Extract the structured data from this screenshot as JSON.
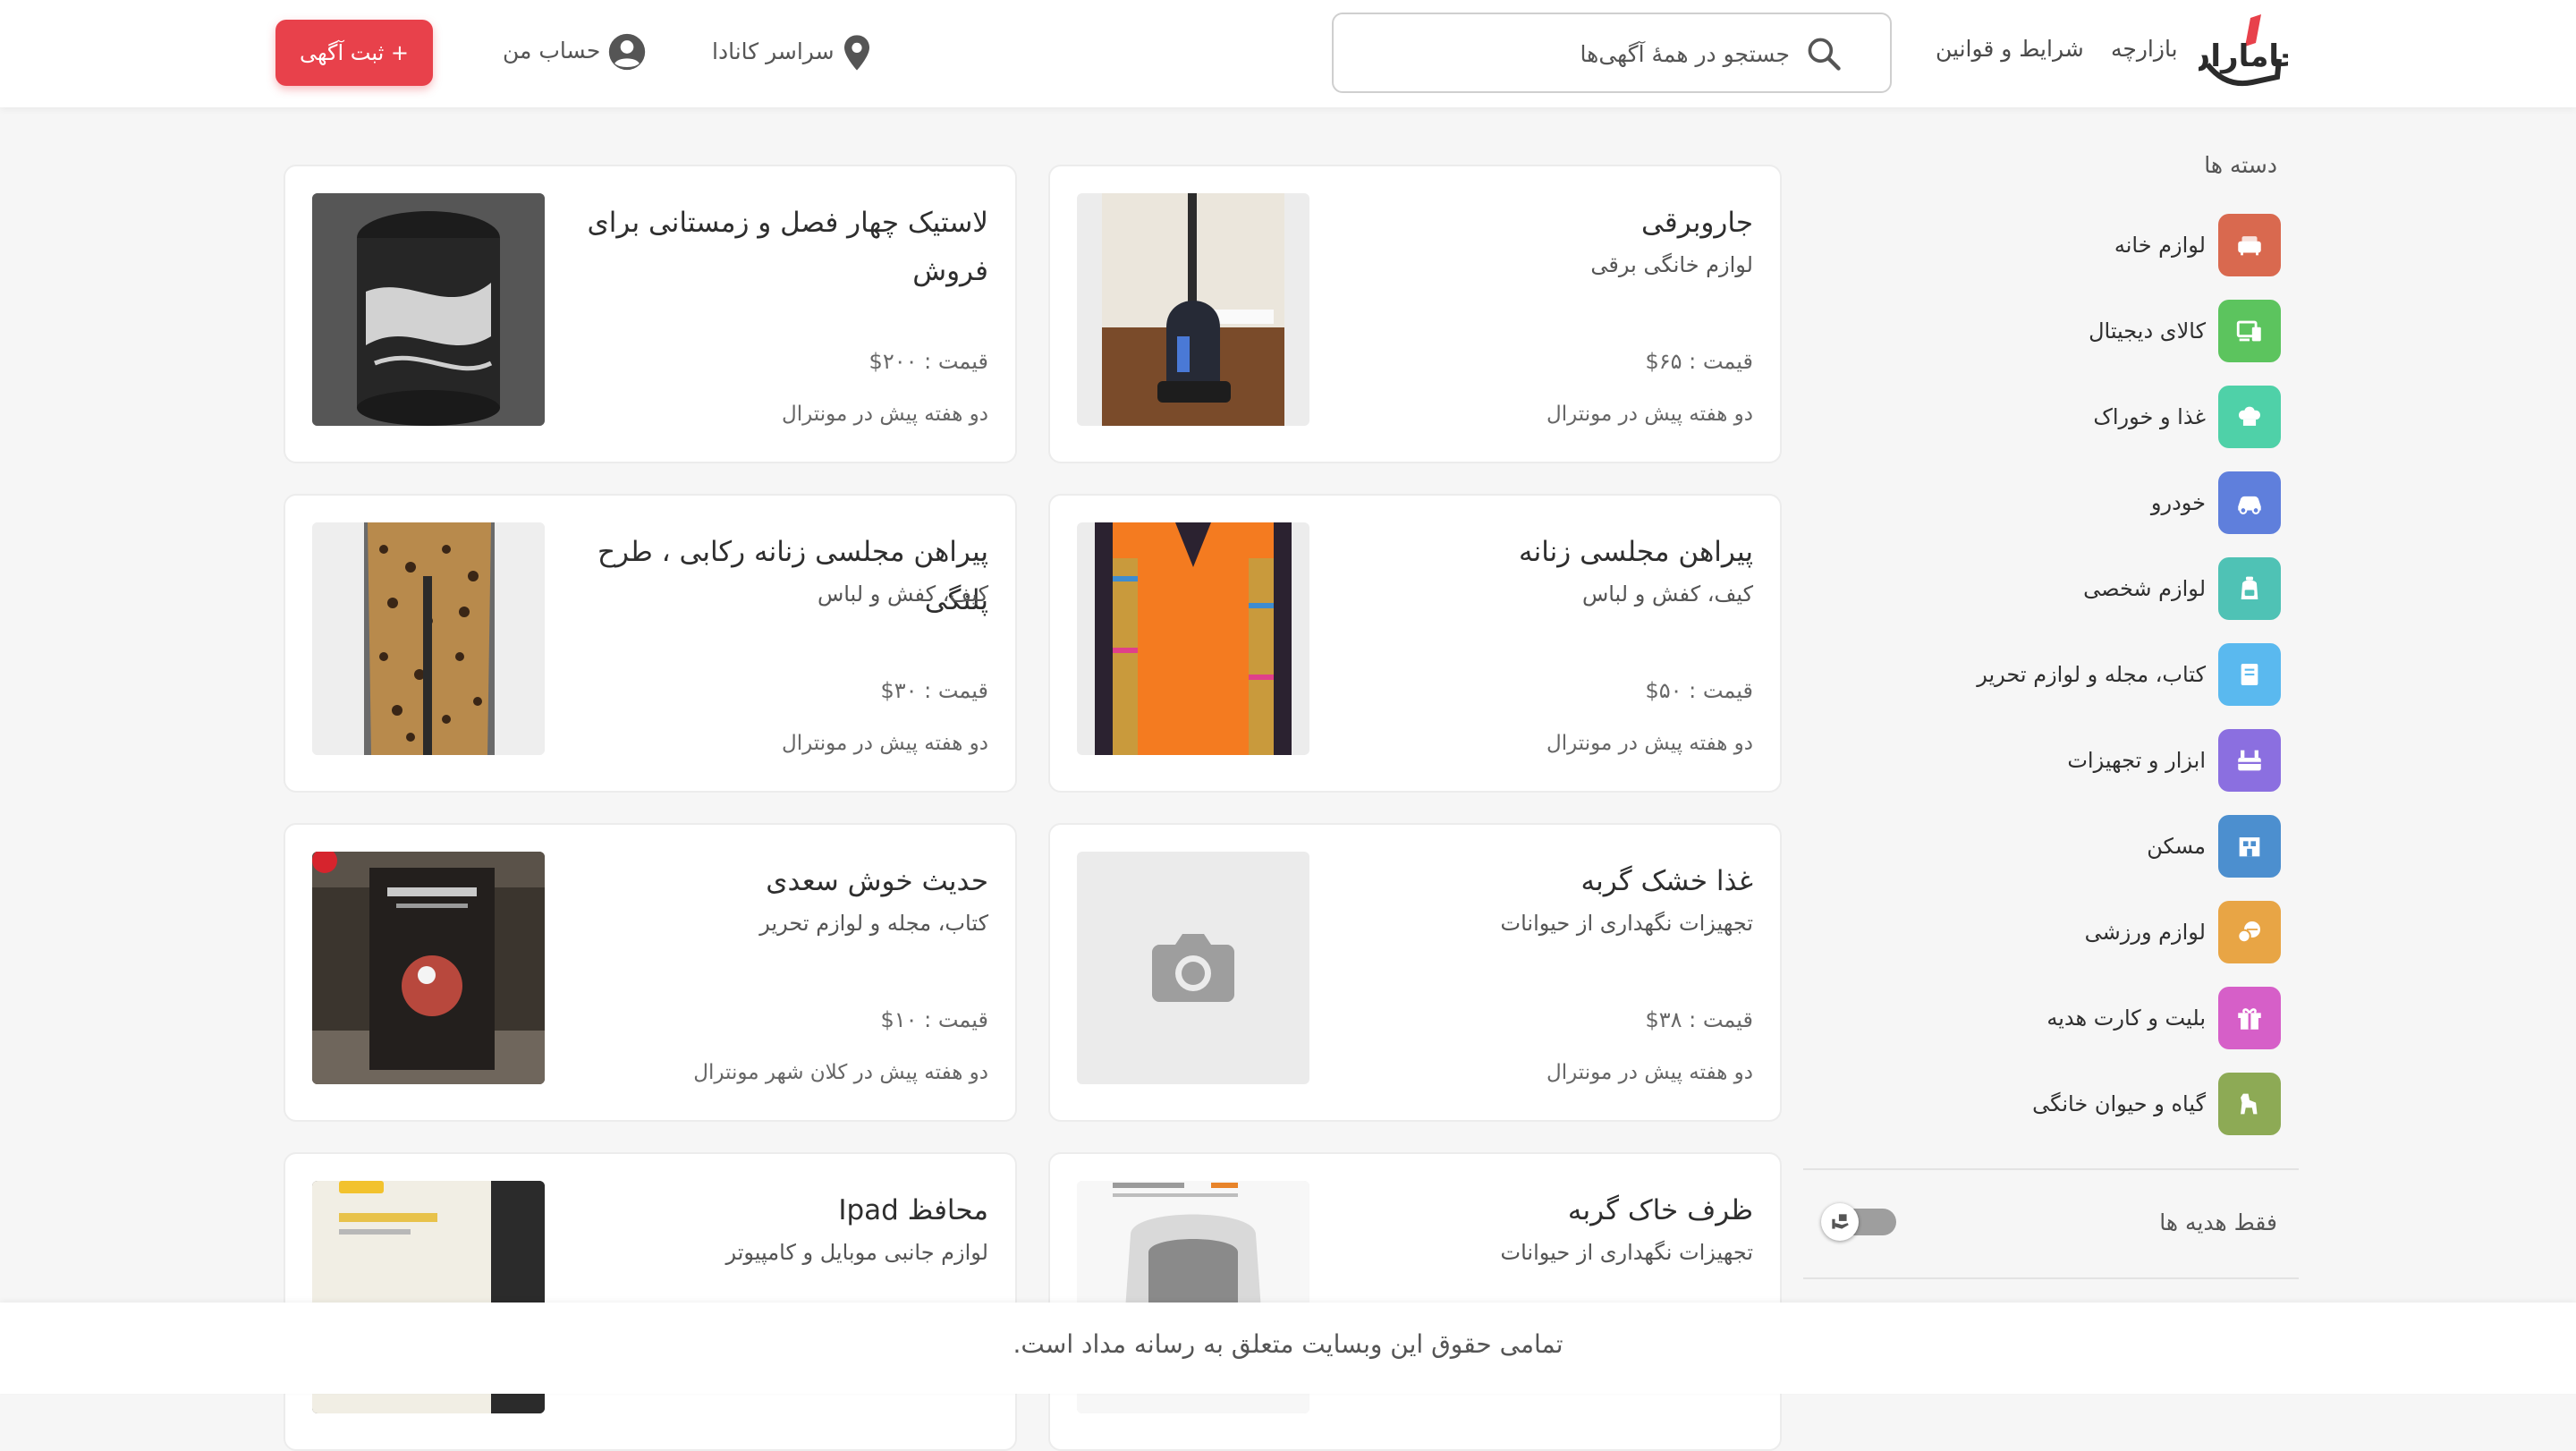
{
  "header": {
    "logo_text": "جاماران",
    "nav": [
      "بازارچه",
      "شرایط و قوانین"
    ],
    "search_placeholder": "جستجو در همهٔ آگهی‌ها",
    "location": "سراسر کانادا",
    "account": "حساب من",
    "post_button": "+ ثبت آگهی"
  },
  "sidebar": {
    "title": "دسته ها",
    "categories": [
      {
        "label": "لوازم خانه",
        "icon": "sofa-icon",
        "color": "#d9694f"
      },
      {
        "label": "کالای دیجیتال",
        "icon": "devices-icon",
        "color": "#5cc45e"
      },
      {
        "label": "غذا و خوراک",
        "icon": "chef-hat-icon",
        "color": "#4fd1a8"
      },
      {
        "label": "خودرو",
        "icon": "car-icon",
        "color": "#5f7fdc"
      },
      {
        "label": "لوازم شخصی",
        "icon": "backpack-icon",
        "color": "#4fc2b5"
      },
      {
        "label": "کتاب، مجله و لوازم تحریر",
        "icon": "book-icon",
        "color": "#5ab9ef"
      },
      {
        "label": "ابزار و تجهیزات",
        "icon": "toolbox-icon",
        "color": "#8b6fe0"
      },
      {
        "label": "مسکن",
        "icon": "house-icon",
        "color": "#4c8fcf"
      },
      {
        "label": "لوازم ورزشی",
        "icon": "sports-ball-icon",
        "color": "#e8a545"
      },
      {
        "label": "بلیت و کارت هدیه",
        "icon": "gift-icon",
        "color": "#d65fc8"
      },
      {
        "label": "گیاه و حیوان خانگی",
        "icon": "dog-icon",
        "color": "#8daa55"
      }
    ],
    "gift_only": "فقط هدیه ها"
  },
  "listings": [
    {
      "title": "جاروبرقی",
      "category": "لوازم خانگی برقی",
      "price": "قیمت : ۶۵$",
      "time": "دو هفته پیش در مونترال",
      "image": "vacuum"
    },
    {
      "title": "لاستیک چهار فصل و زمستانی برای فروش",
      "category": "",
      "price": "قیمت : ۲۰۰$",
      "time": "دو هفته پیش در مونترال",
      "image": "tires"
    },
    {
      "title": "پیراهن مجلسی زنانه",
      "category": "کیف، کفش و لباس",
      "price": "قیمت : ۵۰$",
      "time": "دو هفته پیش در مونترال",
      "image": "orange-dress"
    },
    {
      "title": "پیراهن مجلسی زنانه رکابی ، طرح پلنگی",
      "category": "کیف، کفش و لباس",
      "price": "قیمت : ۳۰$",
      "time": "دو هفته پیش در مونترال",
      "image": "leopard-dress"
    },
    {
      "title": "غذا خشک گربه",
      "category": "تجهیزات نگهداری از حیوانات",
      "price": "قیمت : ۳۸$",
      "time": "دو هفته پیش در مونترال",
      "image": "placeholder"
    },
    {
      "title": "حدیث خوش سعدی",
      "category": "کتاب، مجله و لوازم تحریر",
      "price": "قیمت : ۱۰$",
      "time": "دو هفته پیش در کلان شهر مونترال",
      "image": "book"
    },
    {
      "title": "ظرف خاک گربه",
      "category": "تجهیزات نگهداری از حیوانات",
      "price": "",
      "time": "",
      "image": "litter-box"
    },
    {
      "title": "محافظ Ipad",
      "category": "لوازم جانبی موبایل و کامپیوتر",
      "price": "",
      "time": "",
      "image": "ipad-case"
    }
  ],
  "footer": {
    "text": "تمامی حقوق این وبسایت متعلق به رسانه مداد است."
  }
}
